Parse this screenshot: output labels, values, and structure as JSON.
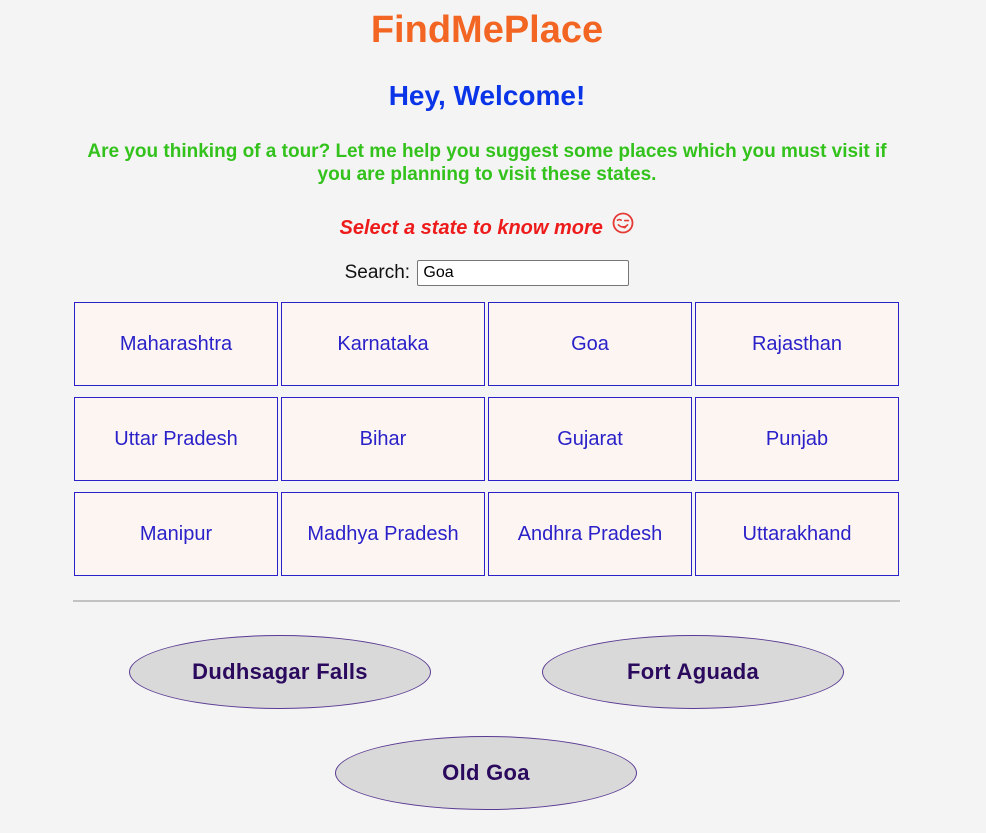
{
  "app": {
    "title": "FindMePlace"
  },
  "welcome": {
    "heading": "Hey, Welcome!",
    "intro": "Are you thinking of a tour? Let me help you suggest some places which you must visit if you are planning to visit these states."
  },
  "prompt": {
    "text": "Select a state to know more",
    "icon": "winking-face-icon"
  },
  "search": {
    "label": "Search:",
    "value": "Goa"
  },
  "states": [
    {
      "label": "Maharashtra"
    },
    {
      "label": "Karnataka"
    },
    {
      "label": "Goa"
    },
    {
      "label": "Rajasthan"
    },
    {
      "label": "Uttar Pradesh"
    },
    {
      "label": "Bihar"
    },
    {
      "label": "Gujarat"
    },
    {
      "label": "Punjab"
    },
    {
      "label": "Manipur"
    },
    {
      "label": "Madhya Pradesh"
    },
    {
      "label": "Andhra Pradesh"
    },
    {
      "label": "Uttarakhand"
    }
  ],
  "places": [
    {
      "label": "Dudhsagar Falls"
    },
    {
      "label": "Fort Aguada"
    },
    {
      "label": "Old Goa"
    }
  ],
  "colors": {
    "page_background": "#f4f4f4",
    "title": "#f26522",
    "welcome": "#0a34e8",
    "intro": "#33c21c",
    "prompt": "#ee1b1b",
    "emoji_stroke": "#e53935",
    "state_text": "#2a21c9",
    "state_border": "#2a21c9",
    "state_background": "#fdf5f2",
    "divider": "#c2c2c2",
    "place_background": "#d9d9d9",
    "place_border": "#5a3a93",
    "place_text": "#2b0a5e"
  }
}
